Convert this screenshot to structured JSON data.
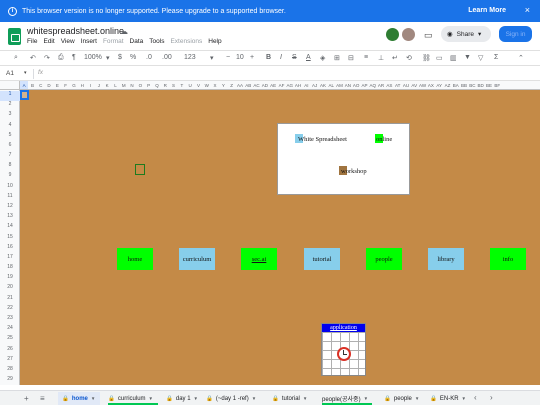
{
  "banner": {
    "message": "This browser version is no longer supported. Please upgrade to a supported browser.",
    "learn_more": "Learn More",
    "close": "×",
    "info": "i"
  },
  "app": {
    "title": "whitespreadsheet.online",
    "cloud_icon": "cloud-icon"
  },
  "menu": [
    "File",
    "Edit",
    "View",
    "Insert",
    "Format",
    "Data",
    "Tools",
    "Extensions",
    "Help"
  ],
  "menu_disabled": [
    "Format",
    "Extensions"
  ],
  "header": {
    "share_label": "Share",
    "signin_label": "Sign in",
    "comment_icon": "comment-icon"
  },
  "toolbar": {
    "zoom": "100%",
    "font_size": "10"
  },
  "formula_bar": {
    "cell_ref": "A1",
    "fx": "fx"
  },
  "grid": {
    "columns": [
      "A",
      "B",
      "C",
      "D",
      "E",
      "F",
      "G",
      "H",
      "I",
      "J",
      "K",
      "L",
      "M",
      "N",
      "O",
      "P",
      "Q",
      "R",
      "S",
      "T",
      "U",
      "V",
      "W",
      "X",
      "Y",
      "Z",
      "AA",
      "AB",
      "AC",
      "AD",
      "AE",
      "AF",
      "AG",
      "AH",
      "AI",
      "AJ",
      "AK",
      "AL",
      "AM",
      "AN",
      "AO",
      "AP",
      "AQ",
      "AR",
      "AS",
      "AT",
      "AU",
      "AV",
      "AW",
      "AX",
      "AY",
      "AZ",
      "BA",
      "BB",
      "BC",
      "BD",
      "BE",
      "BF"
    ],
    "rows": [
      "1",
      "2",
      "3",
      "4",
      "5",
      "6",
      "7",
      "8",
      "9",
      "10",
      "11",
      "12",
      "13",
      "14",
      "15",
      "16",
      "17",
      "18",
      "19",
      "20",
      "21",
      "22",
      "23",
      "24",
      "25",
      "26",
      "27",
      "28",
      "29"
    ],
    "background_color": "#c48a47"
  },
  "panel": {
    "white_spreadsheet": "White Spreadsheet",
    "online": "online",
    "workshop": "workshop"
  },
  "nav_buttons": [
    {
      "label": "home",
      "color": "green",
      "underline": false
    },
    {
      "label": "curriculum",
      "color": "blue",
      "underline": false
    },
    {
      "label": "sec.ai",
      "color": "green",
      "underline": true
    },
    {
      "label": "tutorial",
      "color": "blue",
      "underline": false
    },
    {
      "label": "people",
      "color": "green",
      "underline": false
    },
    {
      "label": "library",
      "color": "blue",
      "underline": false
    },
    {
      "label": "info",
      "color": "green",
      "underline": false
    }
  ],
  "app_widget": {
    "label": "application",
    "icon": "alarm-clock-icon"
  },
  "sheets": [
    {
      "label": "home",
      "active": true
    },
    {
      "label": "curriculum",
      "active": false
    },
    {
      "label": "day 1",
      "active": false
    },
    {
      "label": "(~day 1 -ref)",
      "active": false
    },
    {
      "label": "tutorial",
      "active": false
    },
    {
      "label": "people(공사중)",
      "active": false
    },
    {
      "label": "people",
      "active": false
    },
    {
      "label": "EN-KR",
      "active": false
    }
  ],
  "colors": {
    "banner": "#1a73e8",
    "green": "#00ff00",
    "blue": "#87ceeb",
    "sheets_brand": "#0f9d58"
  }
}
